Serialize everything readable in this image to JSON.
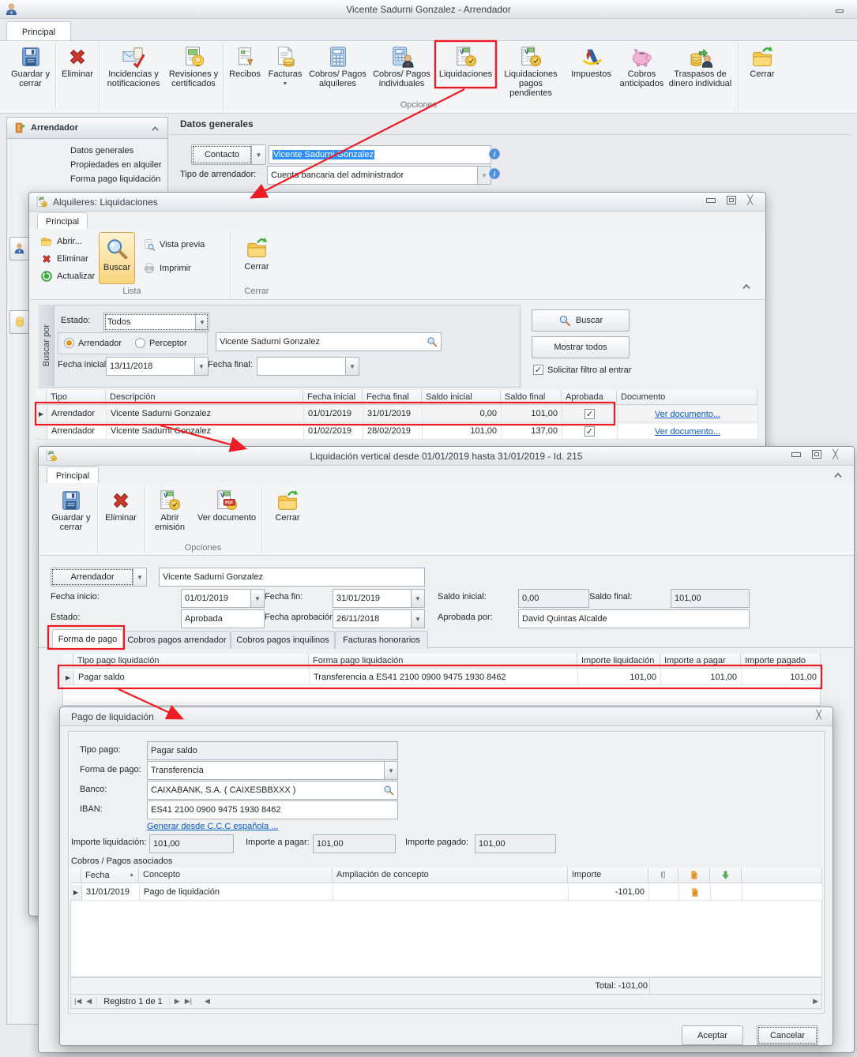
{
  "main": {
    "title": "Vicente Sadurni Gonzalez - Arrendador",
    "tab": "Principal",
    "ribbon": {
      "group_label": "Opciones",
      "buttons": [
        {
          "label": "Guardar y cerrar"
        },
        {
          "label": "Eliminar"
        },
        {
          "label": "Incidencias y notificaciones"
        },
        {
          "label": "Revisiones y certificados"
        },
        {
          "label": "Recibos"
        },
        {
          "label": "Facturas"
        },
        {
          "label": "Cobros/ Pagos alquileres"
        },
        {
          "label": "Cobros/ Pagos individuales"
        },
        {
          "label": "Liquidaciones"
        },
        {
          "label": "Liquidaciones pagos pendientes"
        },
        {
          "label": "Impuestos"
        },
        {
          "label": "Cobros anticipados"
        },
        {
          "label": "Traspasos de dinero individual"
        },
        {
          "label": "Cerrar"
        }
      ]
    },
    "sidebar": {
      "header": "Arrendador",
      "items": [
        {
          "label": "Datos generales"
        },
        {
          "label": "Propiedades en alquiler"
        },
        {
          "label": "Forma pago liquidación"
        }
      ]
    },
    "content": {
      "heading": "Datos generales",
      "contacto_button": "Contacto",
      "contacto_value": "Vicente Sadurni Gonzalez",
      "tipo_arrendador_label": "Tipo de arrendador:",
      "tipo_arrendador_value": "Cuenta bancaria del administrador"
    }
  },
  "liq": {
    "title": "Alquileres: Liquidaciones",
    "tab": "Principal",
    "toolbar": {
      "abrir": "Abrir...",
      "eliminar": "Eliminar",
      "actualizar": "Actualizar",
      "buscar": "Buscar",
      "vista_previa": "Vista previa",
      "imprimir": "Imprimir",
      "cerrar": "Cerrar",
      "group_lista": "Lista",
      "group_cerrar": "Cerrar"
    },
    "filter": {
      "group_label": "Buscar por",
      "estado_label": "Estado:",
      "estado_value": "Todos",
      "radio_arrendador": "Arrendador",
      "radio_perceptor": "Perceptor",
      "search_value": "Vicente Sadurni Gonzalez",
      "fecha_inicial_label": "Fecha inicial:",
      "fecha_inicial_value": "13/11/2018",
      "fecha_final_label": "Fecha final:",
      "buscar_button": "Buscar",
      "mostrar_todos_button": "Mostrar todos",
      "solicitar_filtro_label": "Solicitar filtro al entrar"
    },
    "table": {
      "columns": [
        "Tipo",
        "Descripción",
        "Fecha inicial",
        "Fecha final",
        "Saldo inicial",
        "Saldo final",
        "Aprobada",
        "Documento"
      ],
      "rows": [
        {
          "tipo": "Arrendador",
          "descripcion": "Vicente Sadurni Gonzalez",
          "fecha_inicial": "01/01/2019",
          "fecha_final": "31/01/2019",
          "saldo_inicial": "0,00",
          "saldo_final": "101,00",
          "documento": "Ver documento..."
        },
        {
          "tipo": "Arrendador",
          "descripcion": "Vicente Sadurni Gonzalez",
          "fecha_inicial": "01/02/2019",
          "fecha_final": "28/02/2019",
          "saldo_inicial": "101,00",
          "saldo_final": "137,00",
          "documento": "Ver documento..."
        }
      ]
    }
  },
  "detail": {
    "title": "Liquidación vertical desde 01/01/2019 hasta 31/01/2019 - Id. 215",
    "tab": "Principal",
    "toolbar": {
      "guardar": "Guardar y cerrar",
      "eliminar": "Eliminar",
      "abrir_emision": "Abrir emisión",
      "ver_documento": "Ver documento",
      "cerrar": "Cerrar",
      "group_opciones": "Opciones"
    },
    "form": {
      "arrendador_button": "Arrendador",
      "arrendador_value": "Vicente Sadurni Gonzalez",
      "fecha_inicio_label": "Fecha inicio:",
      "fecha_inicio_value": "01/01/2019",
      "fecha_fin_label": "Fecha fin:",
      "fecha_fin_value": "31/01/2019",
      "saldo_inicial_label": "Saldo inicial:",
      "saldo_inicial_value": "0,00",
      "saldo_final_label": "Saldo final:",
      "saldo_final_value": "101,00",
      "estado_label": "Estado:",
      "estado_value": "Aprobada",
      "fecha_aprobacion_label": "Fecha aprobación:",
      "fecha_aprobacion_value": "26/11/2018",
      "aprobada_por_label": "Aprobada por:",
      "aprobada_por_value": "David Quintas Alcalde"
    },
    "tabs": [
      {
        "label": "Forma de pago"
      },
      {
        "label": "Cobros pagos arrendador"
      },
      {
        "label": "Cobros pagos inquilinos"
      },
      {
        "label": "Facturas honorarios"
      }
    ],
    "pay_table": {
      "columns": [
        "Tipo pago liquidación",
        "Forma pago liquidación",
        "Importe liquidación",
        "Importe a pagar",
        "Importe pagado"
      ],
      "row": {
        "tipo": "Pagar saldo",
        "forma": "Transferencia a ES41 2100 0900 9475 1930 8462",
        "importe_liquidacion": "101,00",
        "importe_a_pagar": "101,00",
        "importe_pagado": "101,00"
      }
    }
  },
  "pago": {
    "title": "Pago de liquidación",
    "tipo_pago_label": "Tipo pago:",
    "tipo_pago_value": "Pagar saldo",
    "forma_pago_label": "Forma de  pago:",
    "forma_pago_value": "Transferencia",
    "banco_label": "Banco:",
    "banco_value": "CAIXABANK, S.A. ( CAIXESBBXXX )",
    "iban_label": "IBAN:",
    "iban_value": "ES41 2100 0900 9475 1930 8462",
    "generar_link": "Generar desde C.C.C española ...",
    "importe_liquidacion_label": "Importe liquidación:",
    "importe_liquidacion_value": "101,00",
    "importe_a_pagar_label": "Importe a pagar:",
    "importe_a_pagar_value": "101,00",
    "importe_pagado_label": "Importe pagado:",
    "importe_pagado_value": "101,00",
    "asociados_label": "Cobros / Pagos asociados",
    "table": {
      "columns": [
        "Fecha",
        "Concepto",
        "Ampliación de concepto",
        "Importe"
      ],
      "row": {
        "fecha": "31/01/2019",
        "concepto": "Pago de liquidación",
        "ampliacion": "",
        "importe": "-101,00"
      }
    },
    "total": "Total: -101,00",
    "pager": "Registro 1 de 1",
    "aceptar": "Aceptar",
    "cancelar": "Cancelar"
  }
}
